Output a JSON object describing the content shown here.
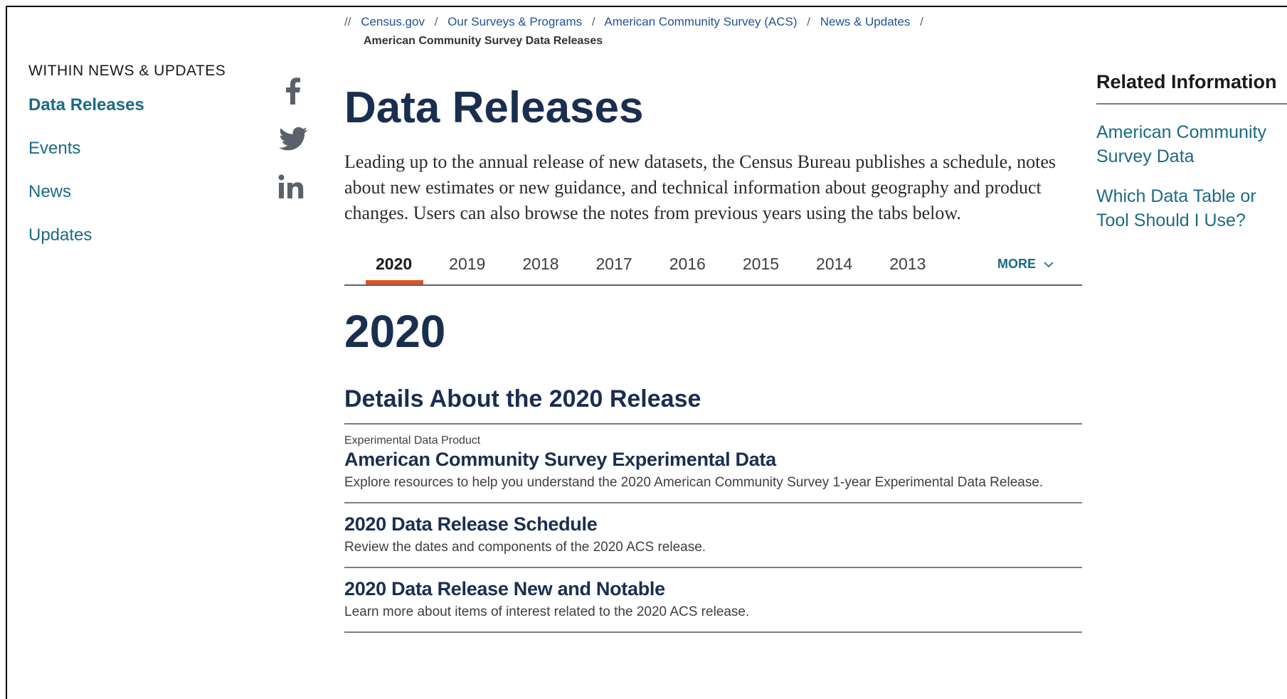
{
  "breadcrumb": {
    "prefix": "//",
    "items": [
      "Census.gov",
      "Our Surveys & Programs",
      "American Community Survey (ACS)",
      "News & Updates"
    ],
    "current": "American Community Survey Data Releases"
  },
  "sidebar": {
    "heading": "WITHIN NEWS & UPDATES",
    "items": [
      {
        "label": "Data Releases",
        "active": true
      },
      {
        "label": "Events"
      },
      {
        "label": "News"
      },
      {
        "label": "Updates"
      }
    ]
  },
  "share": {
    "icons": [
      "facebook-icon",
      "twitter-icon",
      "linkedin-icon"
    ]
  },
  "main": {
    "title": "Data Releases",
    "intro": "Leading up to the annual release of new datasets, the Census Bureau publishes a schedule, notes about new estimates or new guidance, and technical information about geography and product changes. Users can also browse the notes from previous years using the tabs below.",
    "tabs": [
      "2020",
      "2019",
      "2018",
      "2017",
      "2016",
      "2015",
      "2014",
      "2013"
    ],
    "active_tab": "2020",
    "more_label": "MORE",
    "year_heading": "2020",
    "section_heading": "Details About the 2020 Release",
    "items": [
      {
        "eyebrow": "Experimental Data Product",
        "title": "American Community Survey Experimental Data",
        "desc": "Explore resources to help you understand the 2020 American Community Survey 1-year Experimental Data Release."
      },
      {
        "title": "2020 Data Release Schedule",
        "desc": "Review the dates and components of the 2020 ACS release."
      },
      {
        "title": "2020 Data Release New and Notable",
        "desc": "Learn more about items of interest related to the 2020 ACS release."
      }
    ]
  },
  "related": {
    "heading": "Related Information",
    "links": [
      "American Community Survey Data",
      "Which Data Table or Tool Should I Use?"
    ]
  },
  "colors": {
    "link": "#1b6b83",
    "heading": "#1a2e4f",
    "tab_accent": "#e5501f"
  }
}
